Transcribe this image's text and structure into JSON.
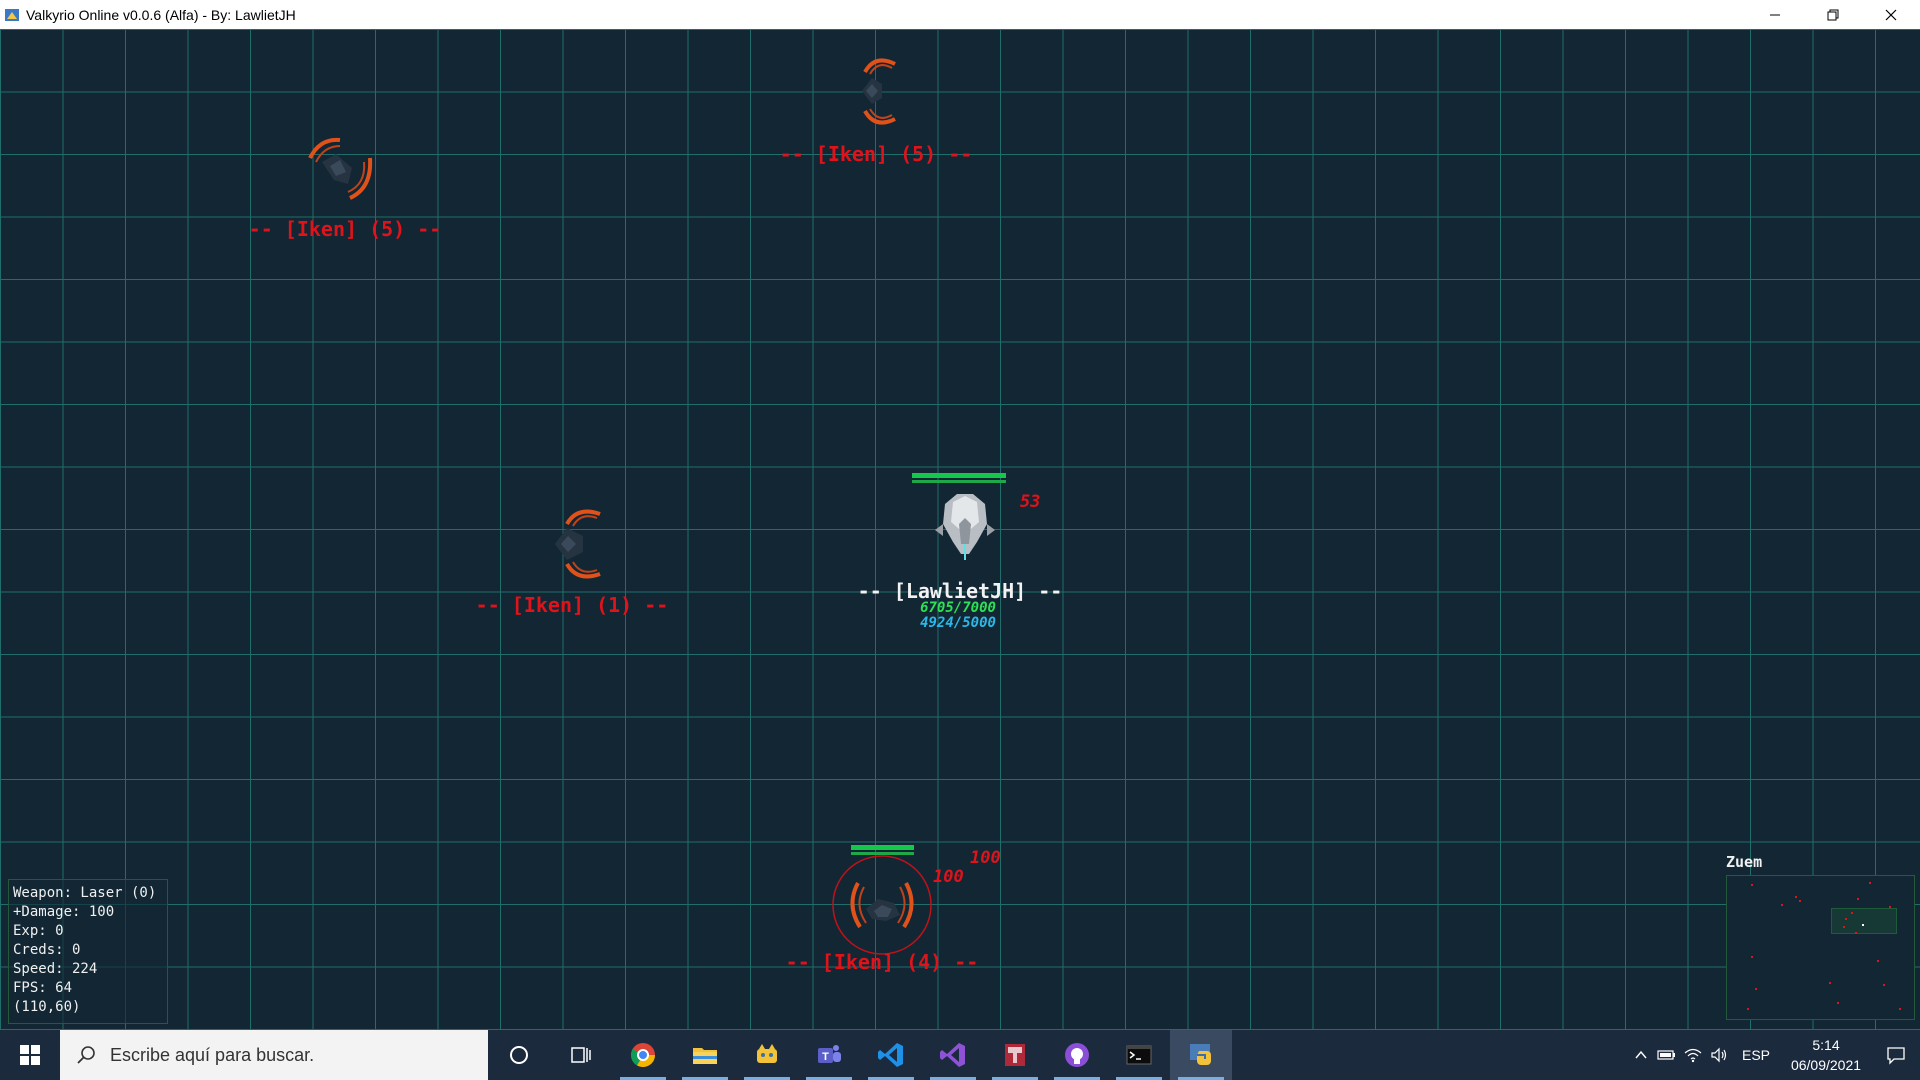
{
  "window": {
    "title": "Valkyrio Online v0.0.6 (Alfa) - By: LawlietJH"
  },
  "game": {
    "enemies": [
      {
        "label": "-- [Iken] (5) --"
      },
      {
        "label": "-- [Iken] (5) --"
      },
      {
        "label": "-- [Iken] (1) --"
      },
      {
        "label": "-- [Iken] (4) --",
        "health_fraction": 1.0
      }
    ],
    "player": {
      "label": "-- [LawlietJH] --",
      "hp": "6705/7000",
      "shield": "4924/5000",
      "health_fraction": 0.958
    },
    "damage_numbers": [
      "53",
      "100",
      "100"
    ]
  },
  "hud": {
    "weapon": "Weapon: Laser (0)",
    "damage": "+Damage: 100",
    "exp": "Exp: 0",
    "creds": "Creds: 0",
    "speed": "Speed: 224",
    "fps": "FPS: 64",
    "position": "(110,60)"
  },
  "minimap": {
    "title": "Zuem"
  },
  "taskbar": {
    "search_placeholder": "Escribe aquí para buscar.",
    "language": "ESP",
    "time": "5:14",
    "date": "06/09/2021",
    "apps": [
      "task-view",
      "chrome",
      "file-explorer",
      "python-idle",
      "teams",
      "vscode",
      "visual-studio",
      "archive-app",
      "github-desktop",
      "terminal",
      "python-game"
    ]
  },
  "colors": {
    "background": "#122733",
    "grid": "#1f6e6b",
    "enemy_text": "#e0121a",
    "hp_green": "#2ee055",
    "shield_blue": "#2bb8e8",
    "taskbar": "#1c2a3e"
  }
}
